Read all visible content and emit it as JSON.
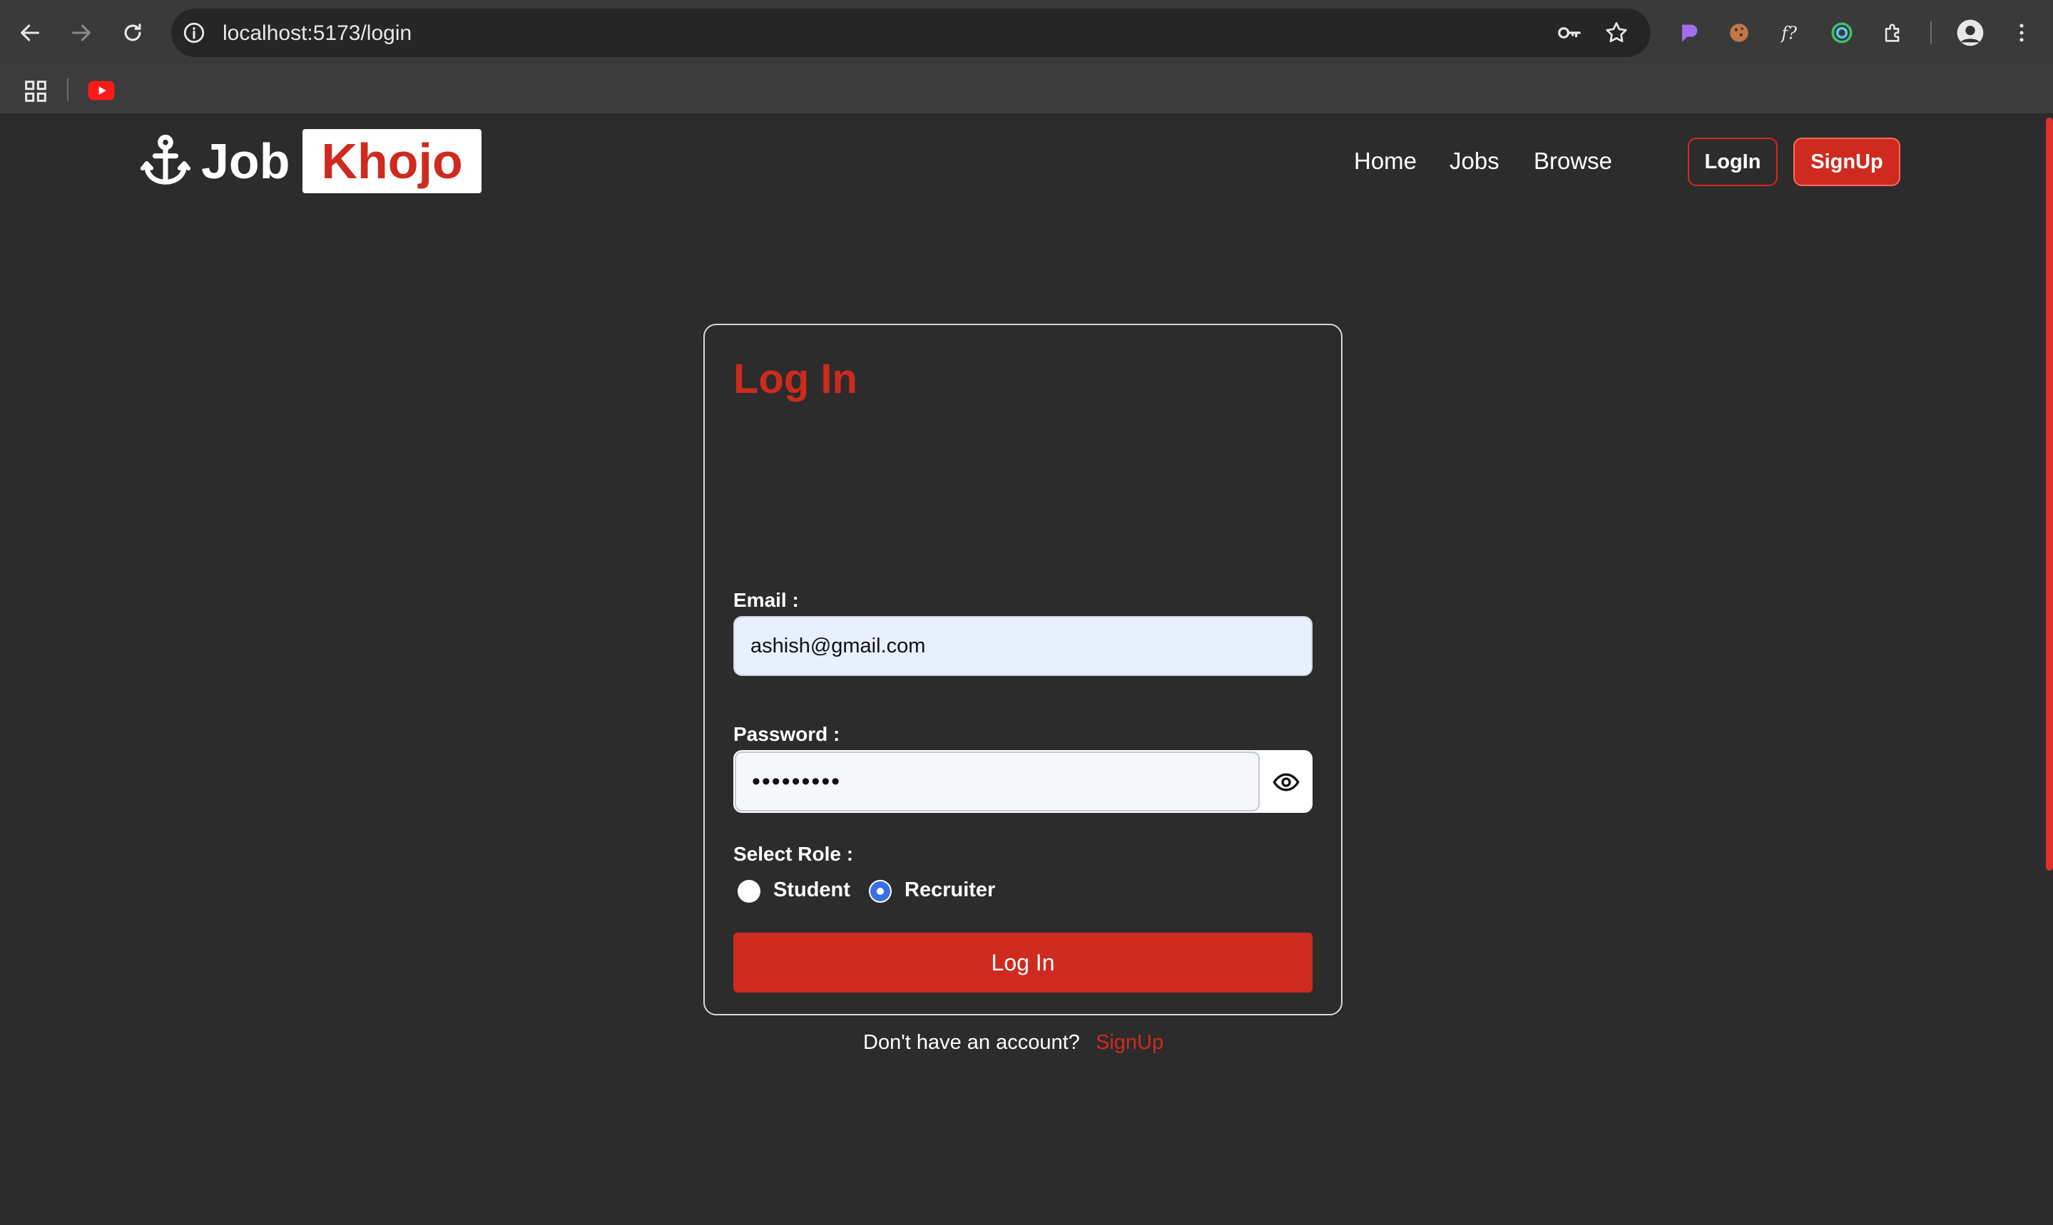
{
  "browser": {
    "url": "localhost:5173/login",
    "accent": "#3c3c3c"
  },
  "header": {
    "logo_text": "Job",
    "logo_highlight": "Khojo",
    "nav": [
      "Home",
      "Jobs",
      "Browse"
    ],
    "login_label": "LogIn",
    "signup_label": "SignUp"
  },
  "form": {
    "title": "Log In",
    "email_label": "Email :",
    "email_value": "ashish@gmail.com",
    "password_label": "Password :",
    "password_value": "•••••••••",
    "role_label": "Select Role :",
    "roles": [
      "Student",
      "Recruiter"
    ],
    "selected_role": "Recruiter",
    "submit_label": "Log In",
    "no_account_text": "Don't have an account?",
    "signup_link": "SignUp"
  },
  "colors": {
    "brand_red": "#cf2a1f",
    "background": "#2c2c2c",
    "radio_selected": "#3b6fe0"
  }
}
